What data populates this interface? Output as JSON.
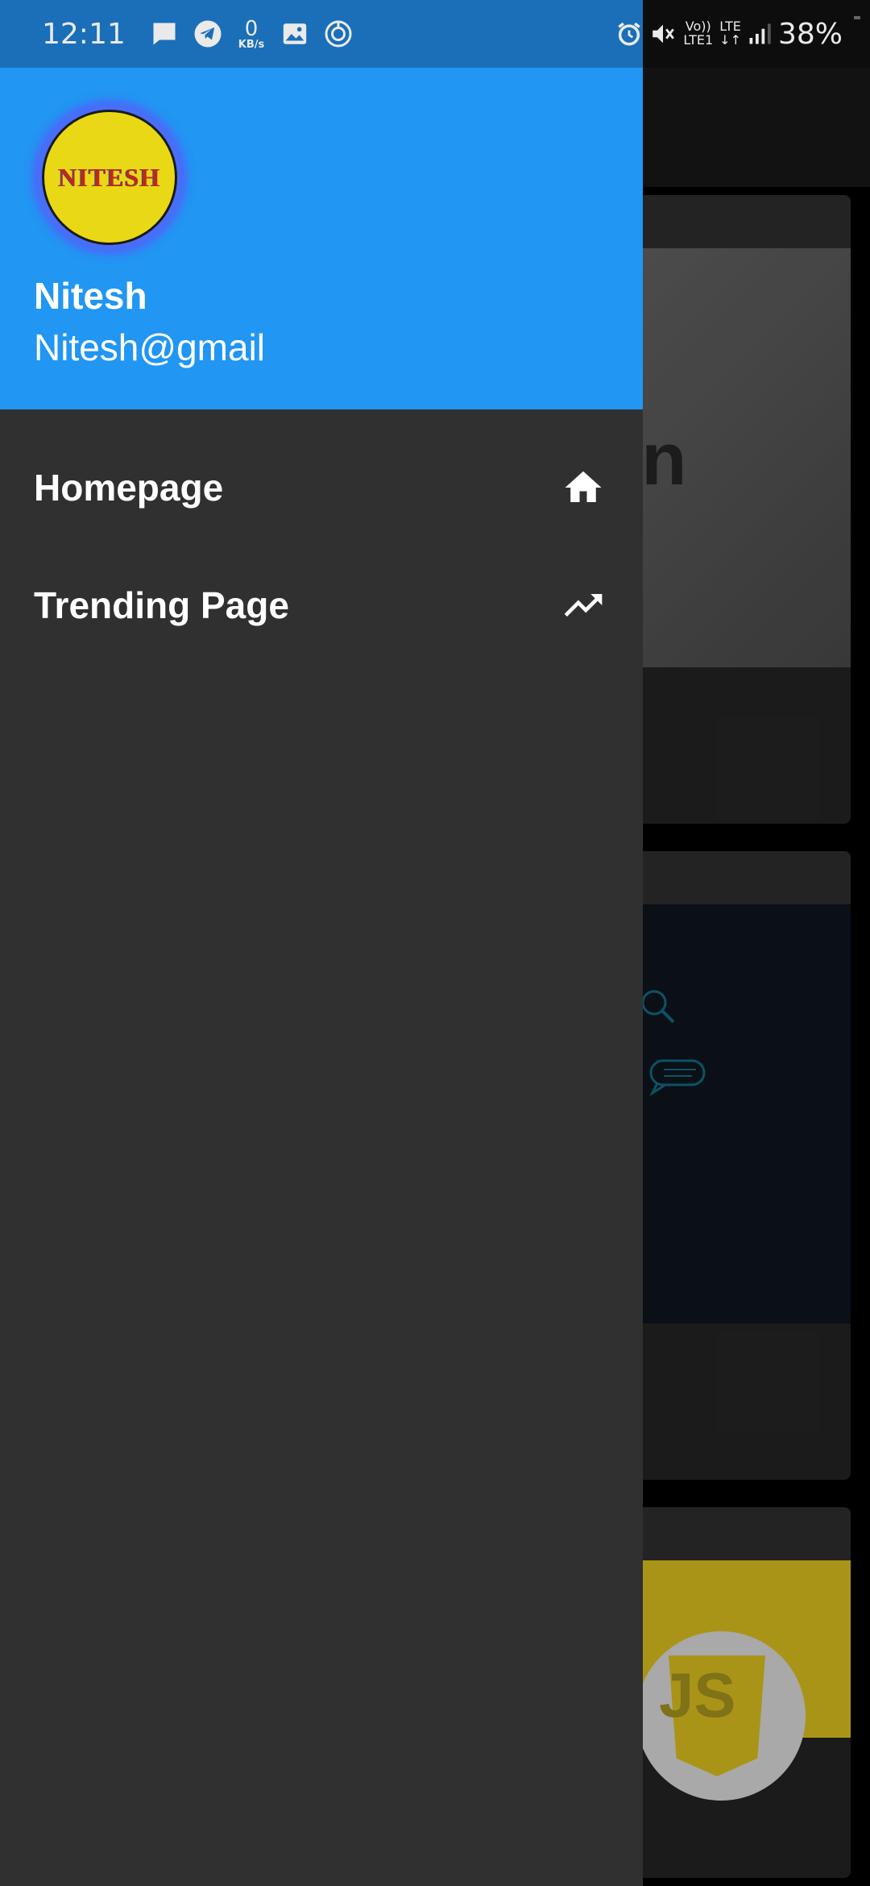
{
  "status_bar": {
    "time": "12:11",
    "net_speed_value": "0",
    "net_speed_unit": "KB/s",
    "volte_top": "Vo))",
    "volte_bottom": "LTE1",
    "lte_top": "LTE",
    "lte_bottom": "↓↑",
    "battery_percent": "38%",
    "battery_level": 0.38,
    "icons": [
      "message-icon",
      "telegram-icon",
      "gallery-icon",
      "sync-icon",
      "alarm-icon",
      "mute-icon",
      "signal-icon",
      "battery-icon"
    ]
  },
  "drawer": {
    "avatar_text": "NITESH",
    "user_name": "Nitesh",
    "user_email": "Nitesh@gmail",
    "header_color": "#2196f3",
    "items": [
      {
        "label": "Homepage",
        "icon": "home-icon"
      },
      {
        "label": "Trending Page",
        "icon": "trending-up-icon"
      }
    ]
  },
  "background": {
    "card1_text": "on",
    "card3_badge": "JS"
  }
}
